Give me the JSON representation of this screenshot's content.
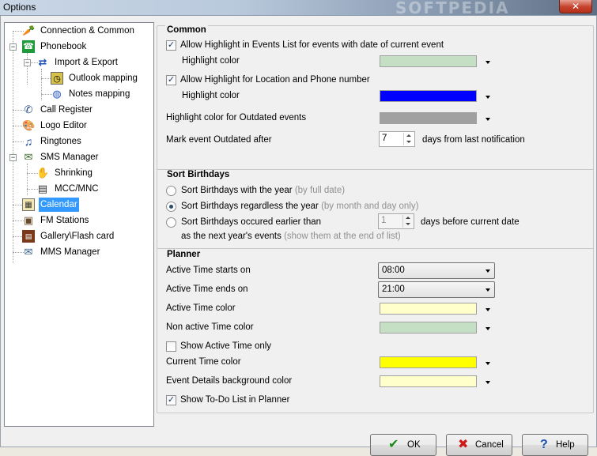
{
  "window": {
    "title": "Options",
    "watermark": "SOFTPEDIA",
    "close_label": "✕"
  },
  "tree": {
    "items": [
      {
        "label": "Connection & Common",
        "icon": "carrot-icon"
      },
      {
        "label": "Phonebook",
        "icon": "phone-icon"
      },
      {
        "label": "Import & Export",
        "icon": "sync-arrows-icon"
      },
      {
        "label": "Outlook mapping",
        "icon": "clock-icon"
      },
      {
        "label": "Notes mapping",
        "icon": "globe-icon"
      },
      {
        "label": "Call Register",
        "icon": "call-register-icon"
      },
      {
        "label": "Logo Editor",
        "icon": "palette-icon"
      },
      {
        "label": "Ringtones",
        "icon": "music-note-icon"
      },
      {
        "label": "SMS Manager",
        "icon": "sms-icon"
      },
      {
        "label": "Shrinking",
        "icon": "hand-icon"
      },
      {
        "label": "MCC/MNC",
        "icon": "antenna-icon"
      },
      {
        "label": "Calendar",
        "icon": "calendar-icon"
      },
      {
        "label": "FM Stations",
        "icon": "radio-icon"
      },
      {
        "label": "Gallery\\Flash card",
        "icon": "gallery-icon"
      },
      {
        "label": "MMS Manager",
        "icon": "mms-icon"
      }
    ],
    "selected": "Calendar"
  },
  "common": {
    "title": "Common",
    "highlight_events_label": "Allow Highlight in Events List for events with date of current event",
    "highlight_events_checked": true,
    "highlight_color_label_1": "Highlight color",
    "highlight_color_1": "#c4dfc4",
    "highlight_location_label": "Allow Highlight for Location and Phone number",
    "highlight_location_checked": true,
    "highlight_color_label_2": "Highlight color",
    "highlight_color_2": "#0000ff",
    "outdated_color_label": "Highlight color for Outdated events",
    "outdated_color": "#a0a0a0",
    "mark_outdated_label": "Mark event Outdated after",
    "mark_outdated_value": "7",
    "mark_outdated_suffix": "days from last notification"
  },
  "birthdays": {
    "title": "Sort Birthdays",
    "opt1_label": "Sort Birthdays with the year",
    "opt1_hint": "(by full date)",
    "opt2_label": "Sort Birthdays regardless the year",
    "opt2_hint": "(by month and day only)",
    "opt3_label": "Sort Birthdays occured earlier than",
    "opt3_value": "1",
    "opt3_suffix": "days before current date",
    "opt3_line2": "as the next year's events",
    "opt3_hint": "(show them at the end of list)",
    "selected": 2
  },
  "planner": {
    "title": "Planner",
    "active_start_label": "Active Time starts on",
    "active_start_value": "08:00",
    "active_end_label": "Active Time ends on",
    "active_end_value": "21:00",
    "active_color_label": "Active Time color",
    "active_color": "#ffffcc",
    "nonactive_color_label": "Non active Time color",
    "nonactive_color": "#c4dfc4",
    "show_active_only_label": "Show Active Time only",
    "show_active_only_checked": false,
    "current_color_label": "Current Time color",
    "current_color": "#ffff00",
    "details_bg_label": "Event Details background color",
    "details_bg_color": "#ffffcc",
    "show_todo_label": "Show To-Do List in Planner",
    "show_todo_checked": true
  },
  "buttons": {
    "ok_label": "OK",
    "cancel_label": "Cancel",
    "help_label": "Help"
  },
  "colors": {
    "ok_check": "#1a8a1a",
    "cancel_x": "#cc1a1a",
    "help_icon": "#1a4fb5",
    "selection": "#3399ff"
  }
}
